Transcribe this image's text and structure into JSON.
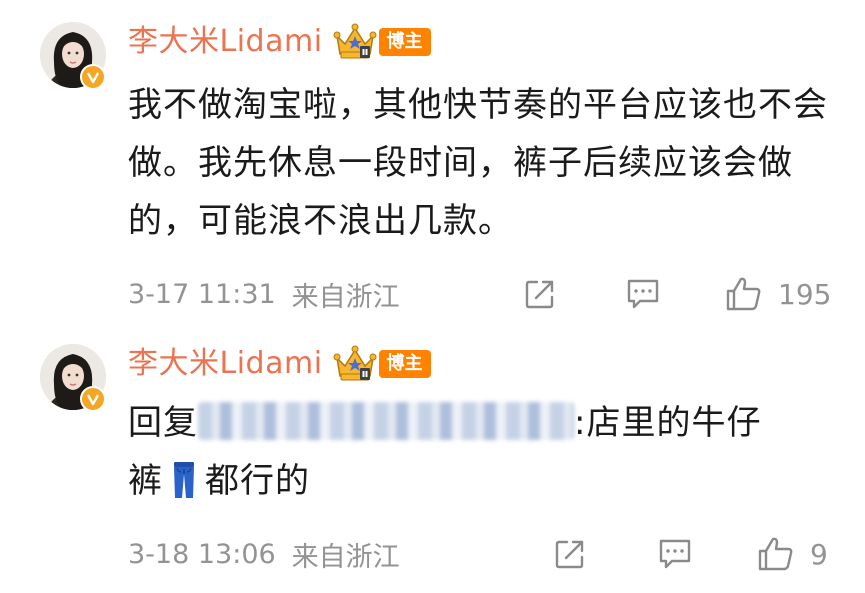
{
  "comments": [
    {
      "username": "李大米Lidami",
      "tag": "博主",
      "crown_icon": "crown-level-icon",
      "verified_icon": "verified-v-badge",
      "content": "我不做淘宝啦，其他快节奏的平台应该也不会做。我先休息一段时间，裤子后续应该会做的，可能浪不浪出几款。",
      "timestamp": "3-17 11:31",
      "location": "来自浙江",
      "likes": "195",
      "accent_color": "#eb7350"
    },
    {
      "username": "李大米Lidami",
      "tag": "博主",
      "crown_icon": "crown-level-icon",
      "verified_icon": "verified-v-badge",
      "reply_prefix": "回复",
      "reply_suffix": ":店里的牛仔",
      "content_tail_before": "裤",
      "emoji": "jeans-emoji",
      "content_tail_after": "都行的",
      "timestamp": "3-18 13:06",
      "location": "来自浙江",
      "likes": "9",
      "accent_color": "#eb7350"
    }
  ]
}
